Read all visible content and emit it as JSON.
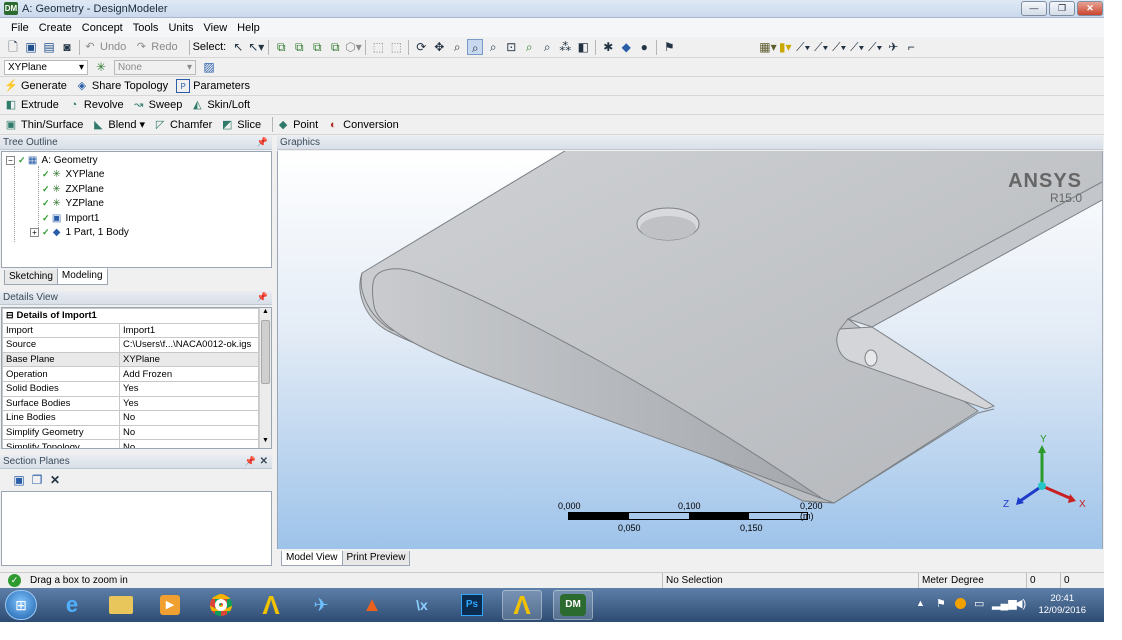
{
  "window": {
    "title": "A: Geometry - DesignModeler",
    "app_icon_text": "DM",
    "minimize": "—",
    "maximize": "❐",
    "close": "✕"
  },
  "menu": [
    "File",
    "Create",
    "Concept",
    "Tools",
    "Units",
    "View",
    "Help"
  ],
  "toolbar1": {
    "undo": "Undo",
    "redo": "Redo",
    "select_label": "Select:"
  },
  "toolbar2": {
    "plane_combo": "XYPlane",
    "sketch_combo": "None"
  },
  "toolbar3": {
    "generate": "Generate",
    "share_topology": "Share Topology",
    "parameters": "Parameters"
  },
  "toolbar4": {
    "extrude": "Extrude",
    "revolve": "Revolve",
    "sweep": "Sweep",
    "skin_loft": "Skin/Loft"
  },
  "toolbar5": {
    "thin_surface": "Thin/Surface",
    "blend": "Blend",
    "chamfer": "Chamfer",
    "slice": "Slice",
    "point": "Point",
    "conversion": "Conversion"
  },
  "tree": {
    "header": "Tree Outline",
    "root": "A: Geometry",
    "items": [
      "XYPlane",
      "ZXPlane",
      "YZPlane",
      "Import1",
      "1 Part, 1 Body"
    ],
    "tabs": [
      "Sketching",
      "Modeling"
    ]
  },
  "details": {
    "header": "Details View",
    "title": "Details of Import1",
    "rows": [
      {
        "key": "Import",
        "value": "Import1"
      },
      {
        "key": "Source",
        "value": "C:\\Users\\f...\\NACA0012-ok.igs"
      },
      {
        "key": "Base Plane",
        "value": "XYPlane"
      },
      {
        "key": "Operation",
        "value": "Add Frozen"
      },
      {
        "key": "Solid Bodies",
        "value": "Yes"
      },
      {
        "key": "Surface Bodies",
        "value": "Yes"
      },
      {
        "key": "Line Bodies",
        "value": "No"
      },
      {
        "key": "Simplify Geometry",
        "value": "No"
      },
      {
        "key": "Simplify Topology",
        "value": "No"
      }
    ]
  },
  "section_planes": {
    "header": "Section Planes"
  },
  "graphics": {
    "header": "Graphics",
    "brand": "ANSYS",
    "version": "R15.0",
    "scale_top": [
      "0,000",
      "0,100",
      "0,200 (m)"
    ],
    "scale_bottom": [
      "0,050",
      "0,150"
    ],
    "axes": {
      "x": "X",
      "y": "Y",
      "z": "Z"
    },
    "tabs": [
      "Model View",
      "Print Preview"
    ]
  },
  "status": {
    "message": "Drag a box to zoom in",
    "selection": "No Selection",
    "units_length": "Meter",
    "units_angle": "Degree",
    "v1": "0",
    "v2": "0"
  },
  "taskbar": {
    "time": "20:41",
    "date": "12/09/2016"
  },
  "colors": {
    "accent_green": "#2f9a2f",
    "viewport_bottom": "#9ec3ea",
    "taskbar": "#2e4c73"
  }
}
